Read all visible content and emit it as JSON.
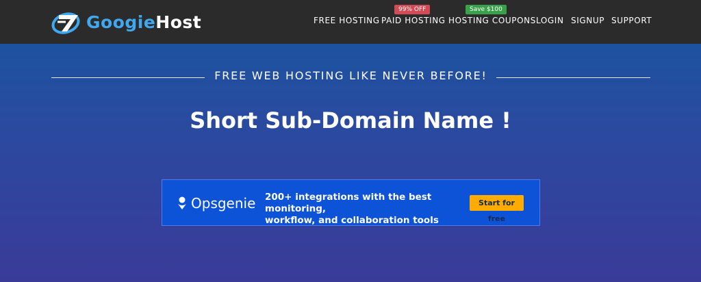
{
  "header": {
    "logo": {
      "part1": "Googie",
      "part2": "Host"
    },
    "nav": [
      {
        "label": "FREE HOSTING"
      },
      {
        "label": "PAID HOSTING",
        "badge": "99% OFF",
        "badge_color": "#d14a55"
      },
      {
        "label": "HOSTING COUPONS",
        "badge": "Save $100",
        "badge_color": "#3aa14b"
      },
      {
        "label": "LOGIN"
      },
      {
        "label": "SIGNUP"
      },
      {
        "label": "SUPPORT"
      }
    ]
  },
  "hero": {
    "tagline": "FREE WEB HOSTING LIKE NEVER BEFORE!",
    "headline": "Short Sub-Domain Name !"
  },
  "ad": {
    "brand": "Opsgenie",
    "line1": "200+ integrations with the best monitoring,",
    "line2": "workflow, and collaboration tools",
    "cta": "Start for free",
    "bg_color": "#0c53d8",
    "cta_color": "#ffab00"
  },
  "colors": {
    "navbar": "#2b2b2b",
    "logo_accent": "#3fa8ee",
    "gradient_top": "#1656a1",
    "gradient_bottom": "#3a3b99"
  }
}
